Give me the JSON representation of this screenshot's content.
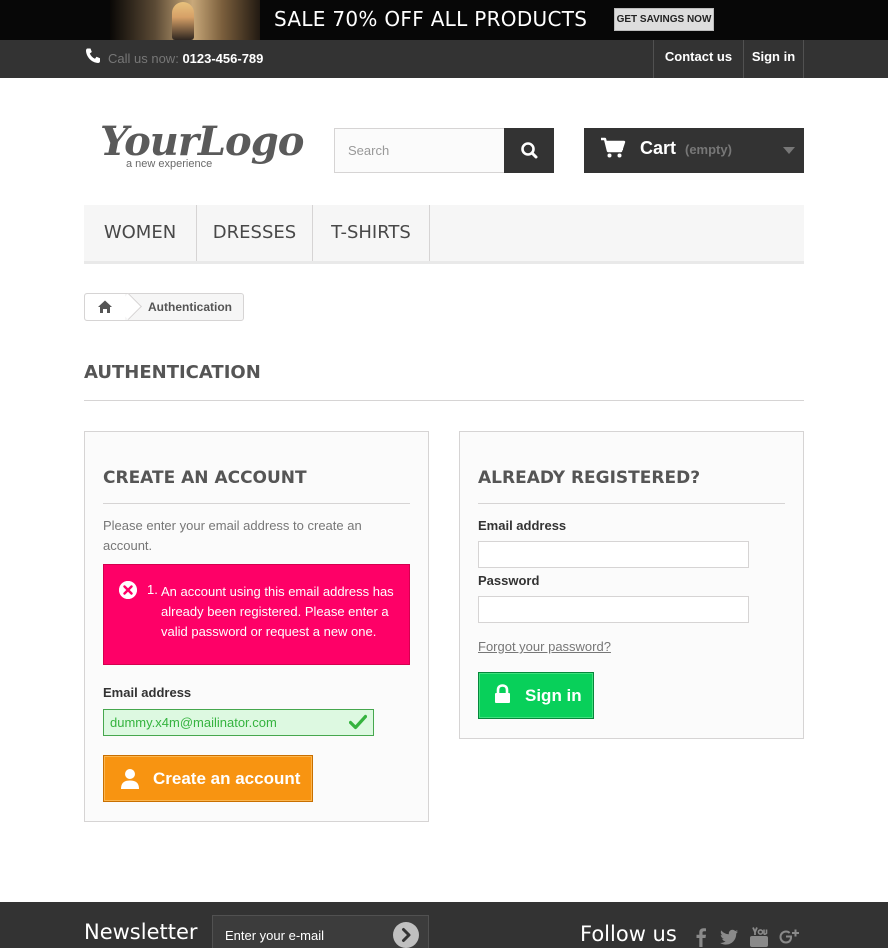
{
  "banner": {
    "headline": "SALE 70% OFF ALL PRODUCTS",
    "button": "GET SAVINGS NOW"
  },
  "topbar": {
    "call_prefix": "Call us now:",
    "phone": "0123-456-789",
    "contact": "Contact us",
    "signin": "Sign in"
  },
  "header": {
    "logo_main": "YourLogo",
    "logo_sub": "a new experience",
    "search_placeholder": "Search",
    "cart_label": "Cart",
    "cart_status": "(empty)"
  },
  "menu": {
    "items": [
      {
        "label": "WOMEN"
      },
      {
        "label": "DRESSES"
      },
      {
        "label": "T-SHIRTS"
      }
    ]
  },
  "breadcrumb": {
    "current": "Authentication"
  },
  "page": {
    "heading": "AUTHENTICATION"
  },
  "create_account": {
    "title": "CREATE AN ACCOUNT",
    "intro": "Please enter your email address to create an account.",
    "error_number": "1.",
    "error_message": "An account using this email address has already been registered. Please enter a valid password or request a new one.",
    "email_label": "Email address",
    "email_value": "dummy.x4m@mailinator.com",
    "button": "Create an account"
  },
  "login": {
    "title": "ALREADY REGISTERED?",
    "email_label": "Email address",
    "email_value": "",
    "password_label": "Password",
    "password_value": "",
    "forgot": "Forgot your password?",
    "button": "Sign in"
  },
  "footer": {
    "newsletter_title": "Newsletter",
    "newsletter_placeholder": "Enter your e-mail",
    "follow_title": "Follow us",
    "social_icons": [
      "facebook-icon",
      "twitter-icon",
      "youtube-icon",
      "google-plus-icon"
    ]
  },
  "colors": {
    "dark": "#333333",
    "error": "#fe0067",
    "success": "#08d05a",
    "warning": "#f89411"
  }
}
